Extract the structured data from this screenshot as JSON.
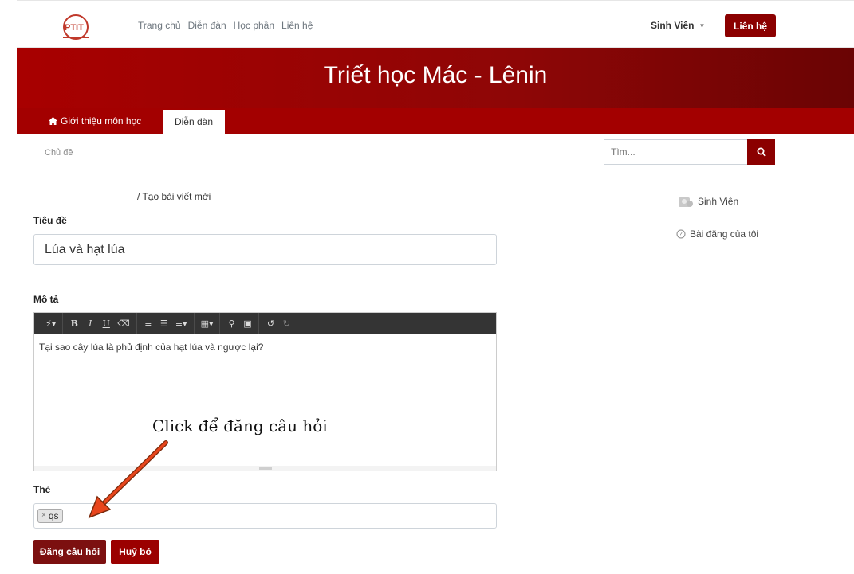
{
  "nav": {
    "links": [
      "Trang chủ",
      "Diễn đàn",
      "Học phần",
      "Liên hệ"
    ],
    "user_label": "Sinh Viên",
    "contact_button": "Liên hệ",
    "logo_text": "PTIT"
  },
  "banner": {
    "title": "Triết học Mác - Lênin"
  },
  "tabs": {
    "intro": "Giới thiệu môn học",
    "forum": "Diễn đàn"
  },
  "subject_label": "Chủ đề",
  "search": {
    "placeholder": "Tìm..."
  },
  "breadcrumb": "/  Tạo bài viết mới",
  "form": {
    "title_label": "Tiêu đề",
    "title_value": "Lúa và hạt lúa",
    "desc_label": "Mô tả",
    "desc_value": "Tại sao cây lúa là phủ định của hạt lúa và ngược lại?",
    "tags_label": "Thẻ",
    "tags": [
      "qs"
    ],
    "submit_button": "Đăng câu hỏi",
    "cancel_button": "Huỷ bỏ"
  },
  "sidebar": {
    "user": "Sinh Viên",
    "my_posts": "Bài đăng của tôi"
  },
  "annotation": "Click để đăng câu hỏi",
  "colors": {
    "brand": "#8b0000",
    "banner": "#a80000",
    "arrow": "#e8451c"
  },
  "editor_toolbar_icons": [
    "magic-icon",
    "bold-icon",
    "italic-icon",
    "underline-icon",
    "eraser-icon",
    "unordered-list-icon",
    "ordered-list-icon",
    "align-icon",
    "table-icon",
    "link-icon",
    "picture-icon",
    "undo-icon",
    "redo-icon"
  ]
}
